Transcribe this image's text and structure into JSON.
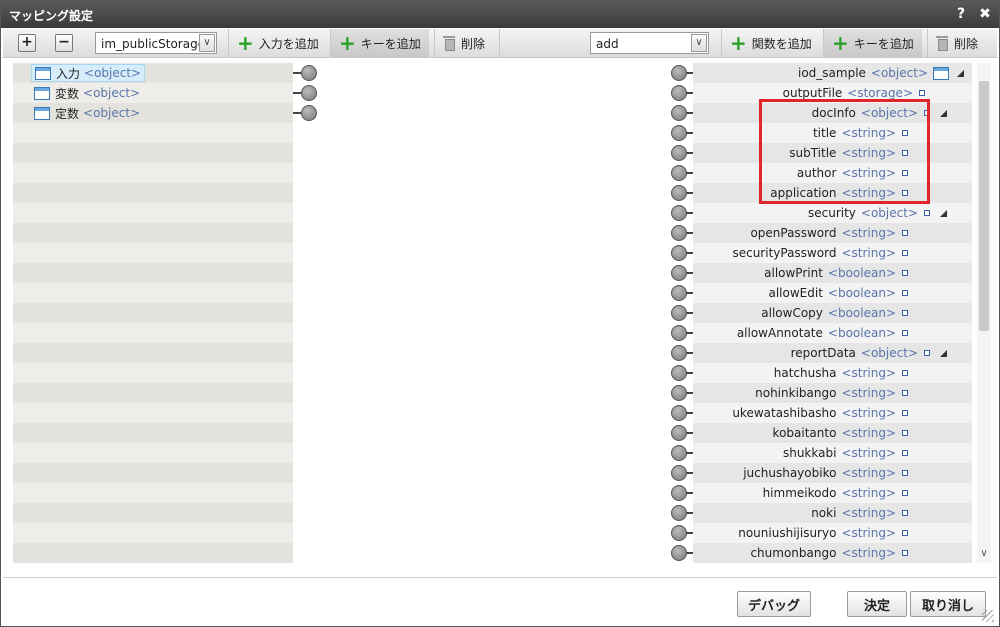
{
  "window": {
    "title": "マッピング設定",
    "help": "?",
    "close": "✖"
  },
  "toolbar": {
    "expand": "+",
    "collapse": "−",
    "storage_select": "im_publicStorage",
    "add_input_label": "入力を追加",
    "add_key_label_left": "キーを追加",
    "delete_label_left": "削除",
    "function_select": "add",
    "add_function_label": "関数を追加",
    "add_key_label_right": "キーを追加",
    "delete_label_right": "削除",
    "dropdown_arrow": "∨"
  },
  "left_items": [
    {
      "name": "入力",
      "type": "<object>"
    },
    {
      "name": "変数",
      "type": "<object>"
    },
    {
      "name": "定数",
      "type": "<object>"
    }
  ],
  "right_items": [
    {
      "name": "iod_sample",
      "type": "<object>",
      "marker": "box-tri"
    },
    {
      "name": "outputFile",
      "type": "<storage>",
      "marker": "sq-pad"
    },
    {
      "name": "docInfo",
      "type": "<object>",
      "marker": "sq-tri"
    },
    {
      "name": "title",
      "type": "<string>",
      "marker": "sq"
    },
    {
      "name": "subTitle",
      "type": "<string>",
      "marker": "sq"
    },
    {
      "name": "author",
      "type": "<string>",
      "marker": "sq"
    },
    {
      "name": "application",
      "type": "<string>",
      "marker": "sq"
    },
    {
      "name": "security",
      "type": "<object>",
      "marker": "sq-tri"
    },
    {
      "name": "openPassword",
      "type": "<string>",
      "marker": "sq"
    },
    {
      "name": "securityPassword",
      "type": "<string>",
      "marker": "sq"
    },
    {
      "name": "allowPrint",
      "type": "<boolean>",
      "marker": "sq"
    },
    {
      "name": "allowEdit",
      "type": "<boolean>",
      "marker": "sq"
    },
    {
      "name": "allowCopy",
      "type": "<boolean>",
      "marker": "sq"
    },
    {
      "name": "allowAnnotate",
      "type": "<boolean>",
      "marker": "sq"
    },
    {
      "name": "reportData",
      "type": "<object>",
      "marker": "sq-tri"
    },
    {
      "name": "hatchusha",
      "type": "<string>",
      "marker": "sq"
    },
    {
      "name": "nohinkibango",
      "type": "<string>",
      "marker": "sq"
    },
    {
      "name": "ukewatashibasho",
      "type": "<string>",
      "marker": "sq"
    },
    {
      "name": "kobaitanto",
      "type": "<string>",
      "marker": "sq"
    },
    {
      "name": "shukkabi",
      "type": "<string>",
      "marker": "sq"
    },
    {
      "name": "juchushayobiko",
      "type": "<string>",
      "marker": "sq"
    },
    {
      "name": "himmeikodo",
      "type": "<string>",
      "marker": "sq"
    },
    {
      "name": "noki",
      "type": "<string>",
      "marker": "sq"
    },
    {
      "name": "nouniushijisuryo",
      "type": "<string>",
      "marker": "sq"
    },
    {
      "name": "chumonbango",
      "type": "<string>",
      "marker": "sq"
    }
  ],
  "footer": {
    "debug_label": "デバッグ",
    "ok_label": "決定",
    "cancel_label": "取り消し"
  },
  "colors": {
    "highlight": "#e0252b",
    "add_icon": "#2aa12a",
    "type_text": "#5a74a8"
  }
}
